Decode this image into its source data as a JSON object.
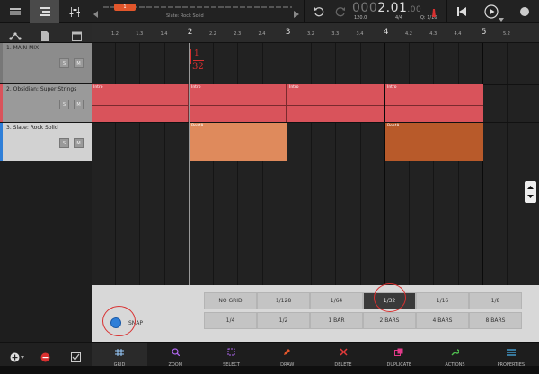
{
  "header": {
    "song_name": "Slate: Rock Solid",
    "playhead_marker": "1",
    "counter": {
      "dim_prefix": "000",
      "bars": "2.01",
      "ticks": ".00"
    },
    "tempo": "120.0",
    "time_signature": "4/4",
    "quantize": "Q: 1/16"
  },
  "ruler": {
    "ticks": [
      {
        "label": "1.2",
        "major": false
      },
      {
        "label": "1.3",
        "major": false
      },
      {
        "label": "1.4",
        "major": false
      },
      {
        "label": "2",
        "major": true
      },
      {
        "label": "2.2",
        "major": false
      },
      {
        "label": "2.3",
        "major": false
      },
      {
        "label": "2.4",
        "major": false
      },
      {
        "label": "3",
        "major": true
      },
      {
        "label": "3.2",
        "major": false
      },
      {
        "label": "3.3",
        "major": false
      },
      {
        "label": "3.4",
        "major": false
      },
      {
        "label": "4",
        "major": true
      },
      {
        "label": "4.2",
        "major": false
      },
      {
        "label": "4.3",
        "major": false
      },
      {
        "label": "4.4",
        "major": false
      },
      {
        "label": "5",
        "major": true
      },
      {
        "label": "5.2",
        "major": false
      }
    ]
  },
  "tracks": [
    {
      "name": "1. MAIN MIX",
      "solo": "S",
      "mute": "M",
      "color": "#d0d0d0"
    },
    {
      "name": "2. Obsidian: Super Strings",
      "solo": "S",
      "mute": "M",
      "color": "#d9535b"
    },
    {
      "name": "3. Slate: Rock Solid",
      "solo": "S",
      "mute": "M",
      "color": "#e07a45"
    }
  ],
  "clips": {
    "strings": [
      {
        "label": "Intro"
      },
      {
        "label": "Intro"
      },
      {
        "label": "Intro"
      },
      {
        "label": "Intro"
      }
    ],
    "drums": [
      {
        "label": "BeatA"
      },
      {
        "label": "BeatA"
      }
    ]
  },
  "annotation": {
    "fraction_top": "1",
    "fraction_bottom": "32"
  },
  "snap": {
    "label": "SNAP",
    "selected": "1/32",
    "row1": [
      "NO GRID",
      "1/128",
      "1/64",
      "1/32",
      "1/16",
      "1/8"
    ],
    "row2": [
      "1/4",
      "1/2",
      "1 BAR",
      "2 BARS",
      "4 BARS",
      "8 BARS"
    ]
  },
  "toolbar": {
    "items": [
      {
        "label": "GRID",
        "icon": "grid-icon",
        "active": true
      },
      {
        "label": "ZOOM",
        "icon": "zoom-icon",
        "active": false
      },
      {
        "label": "SELECT",
        "icon": "select-icon",
        "active": false
      },
      {
        "label": "DRAW",
        "icon": "pencil-icon",
        "active": false
      },
      {
        "label": "DELETE",
        "icon": "delete-icon",
        "active": false
      },
      {
        "label": "DUPLICATE",
        "icon": "duplicate-icon",
        "active": false
      },
      {
        "label": "ACTIONS",
        "icon": "wrench-icon",
        "active": false
      },
      {
        "label": "PROPERTIES",
        "icon": "list-icon",
        "active": false
      }
    ]
  },
  "colors": {
    "accent": "#e2562b",
    "strings_clip": "#d9535b",
    "drums_clip": "#df8a5c",
    "drums_clip_selected": "#b85a2a",
    "snap_toggle": "#2f7fd8",
    "annotation_ink": "#d93030"
  }
}
